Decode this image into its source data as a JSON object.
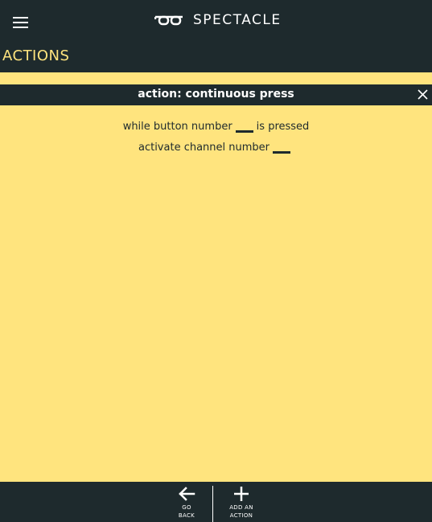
{
  "header": {
    "brand": "SPECTACLE",
    "menu_icon": "hamburger-icon",
    "logo_icon": "glasses-logo"
  },
  "section": {
    "title": "ACTIONS"
  },
  "action": {
    "title": "action: continuous press",
    "close_icon": "close-icon",
    "line1_before": "while button number",
    "line1_after": "is pressed",
    "line2_before": "activate channel number",
    "button_number": "",
    "channel_number": ""
  },
  "footer": {
    "back_label": "GO\nBACK",
    "back_icon": "arrow-left-icon",
    "add_label": "ADD AN\nACTION",
    "add_icon": "plus-icon"
  },
  "colors": {
    "dark": "#1e2a2d",
    "accent": "#ffe47e",
    "text_light": "#ffffff"
  }
}
